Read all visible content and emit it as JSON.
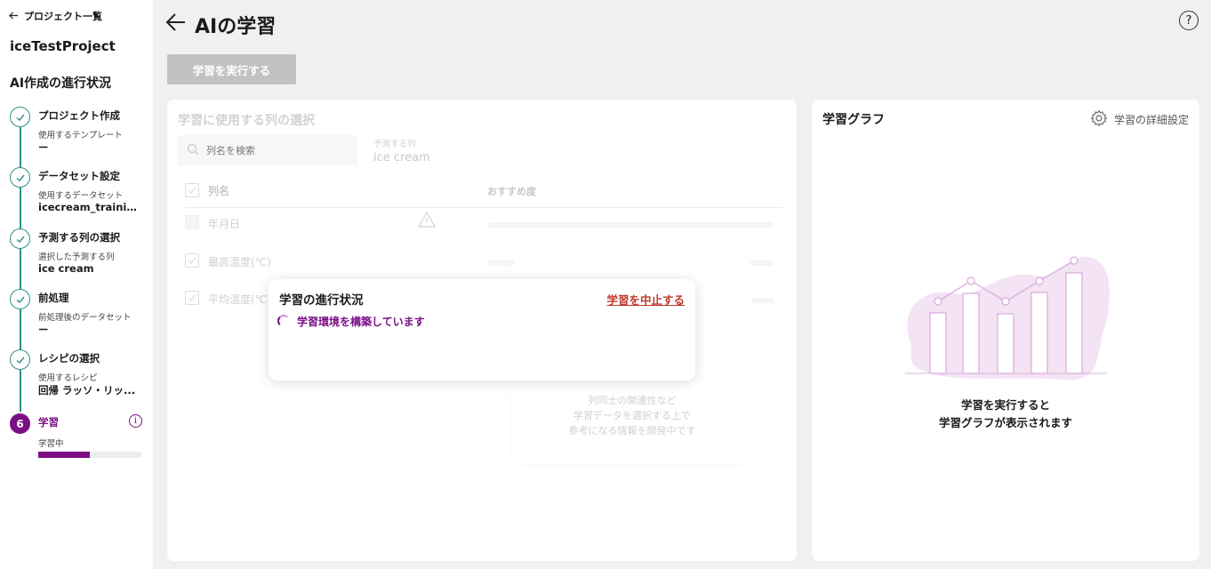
{
  "sidebar": {
    "back_label": "プロジェクト一覧",
    "project_name": "iceTestProject",
    "progress_title": "AI作成の進行状況",
    "steps": [
      {
        "title": "プロジェクト作成",
        "sub": "使用するテンプレート",
        "value": "ー"
      },
      {
        "title": "データセット設定",
        "sub": "使用するデータセット",
        "value": "icecream_training..."
      },
      {
        "title": "予測する列の選択",
        "sub": "選択した予測する列",
        "value": "ice cream"
      },
      {
        "title": "前処理",
        "sub": "前処理後のデータセット",
        "value": "ー"
      },
      {
        "title": "レシピの選択",
        "sub": "使用するレシピ",
        "value": "回帰 ラッソ・リッ..."
      },
      {
        "number": "6",
        "title": "学習",
        "sub": "学習中",
        "progress": 0.5
      }
    ]
  },
  "header": {
    "title": "AIの学習",
    "run_button": "学習を実行する"
  },
  "columns_panel": {
    "title": "学習に使用する列の選択",
    "search_placeholder": "列名を検索",
    "target_label": "予測する列",
    "target_value": "ice cream",
    "col_header": "列名",
    "rec_header": "おすすめ度",
    "rows": [
      "年月日",
      "最高温度(℃)",
      "平均温度(℃"
    ],
    "info_lines": [
      "列同士の関連性など",
      "学習データを選択する上で",
      "参考になる情報を開発中です"
    ]
  },
  "popup": {
    "title": "学習の進行状況",
    "stop_label": "学習を中止する",
    "status": "学習環境を構築しています"
  },
  "graph_panel": {
    "title": "学習グラフ",
    "settings_label": "学習の詳細設定",
    "empty_line1": "学習を実行すると",
    "empty_line2": "学習グラフが表示されます"
  },
  "colors": {
    "accent": "#7b0f86",
    "teal": "#2f8f86",
    "stop": "#c0392b"
  }
}
